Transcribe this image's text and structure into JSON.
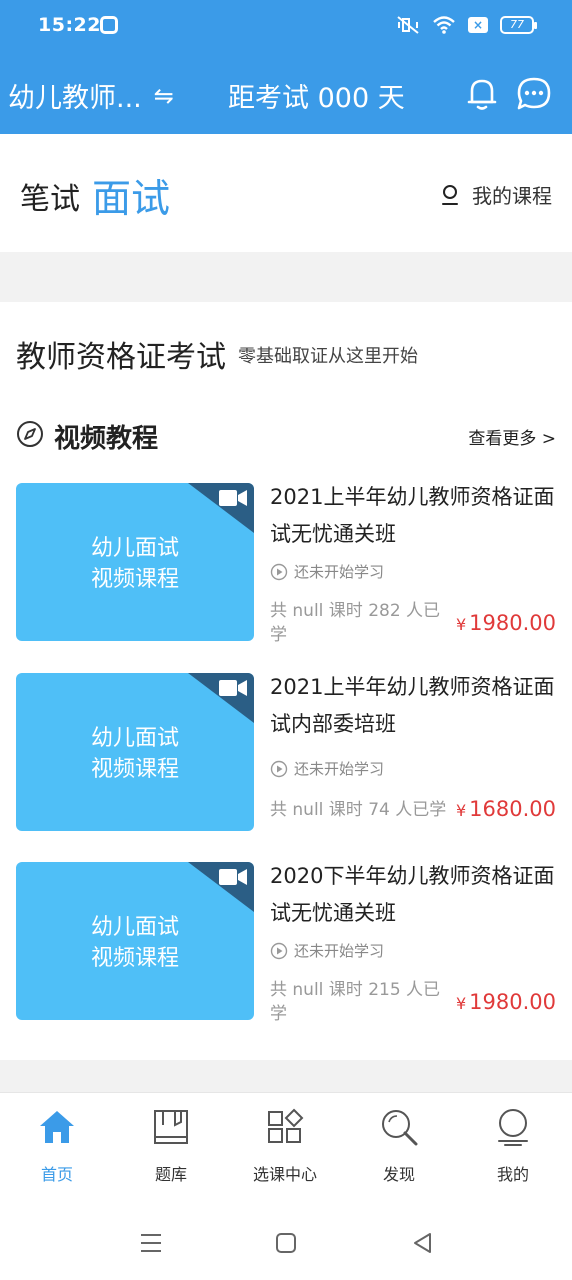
{
  "status_bar": {
    "time": "15:22",
    "battery": "77",
    "sim_label": "×"
  },
  "header": {
    "exam_type": "幼儿教师...",
    "swap_symbol": "⇋",
    "countdown": "距考试 000 天",
    "bell_icon": "bell-icon",
    "chat_icon": "chat-icon",
    "background": "#3b9be8"
  },
  "mode_tabs": {
    "written": "笔试",
    "interview": "面试",
    "my_courses": "我的课程",
    "active_color": "#3b9be8"
  },
  "main": {
    "cert_title": "教师资格证考试",
    "cert_subtitle": "零基础取证从这里开始",
    "section_title": "视频教程",
    "see_more": "查看更多 >",
    "courses": [
      {
        "thumb_line1": "幼儿面试",
        "thumb_line2": "视频课程",
        "title": "2021上半年幼儿教师资格证面试无忧通关班",
        "status": "还未开始学习",
        "meta": "共 null 课时 282 人已学",
        "currency": "¥",
        "price": "1980.00"
      },
      {
        "thumb_line1": "幼儿面试",
        "thumb_line2": "视频课程",
        "title": "2021上半年幼儿教师资格证面试内部委培班",
        "status": "还未开始学习",
        "meta": "共 null 课时 74 人已学",
        "currency": "¥",
        "price": "1680.00"
      },
      {
        "thumb_line1": "幼儿面试",
        "thumb_line2": "视频课程",
        "title": "2020下半年幼儿教师资格证面试无忧通关班",
        "status": "还未开始学习",
        "meta": "共 null 课时 215 人已学",
        "currency": "¥",
        "price": "1980.00"
      }
    ],
    "thumb_color": "#4fbff7",
    "price_color": "#e03a3a"
  },
  "bottom_nav": {
    "items": [
      {
        "label": "首页",
        "icon": "home-icon",
        "active": true
      },
      {
        "label": "题库",
        "icon": "question-bank-icon",
        "active": false
      },
      {
        "label": "选课中心",
        "icon": "course-center-icon",
        "active": false
      },
      {
        "label": "发现",
        "icon": "discover-search-icon",
        "active": false
      },
      {
        "label": "我的",
        "icon": "profile-icon",
        "active": false
      }
    ]
  },
  "system_nav": {
    "menu_icon": "menu-icon",
    "home_icon": "square-home-icon",
    "back_icon": "back-triangle-icon"
  }
}
